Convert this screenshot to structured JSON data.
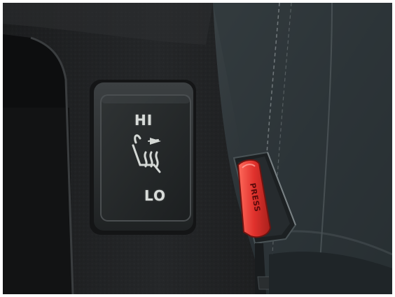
{
  "scene": {
    "subject": "seat-heater-switch-and-seatbelt-buckle",
    "colors": {
      "background_frame": "#ffffff",
      "trim_plastic": "#1c1e20",
      "seat_fabric": "#2a3236",
      "switch_face": "#272a2b",
      "buckle_button": "#e0312c"
    }
  },
  "heater_switch": {
    "hi_label": "HI",
    "lo_label": "LO",
    "icon": "heated-seat-icon"
  },
  "seatbelt_buckle": {
    "button_label": "PRESS"
  }
}
